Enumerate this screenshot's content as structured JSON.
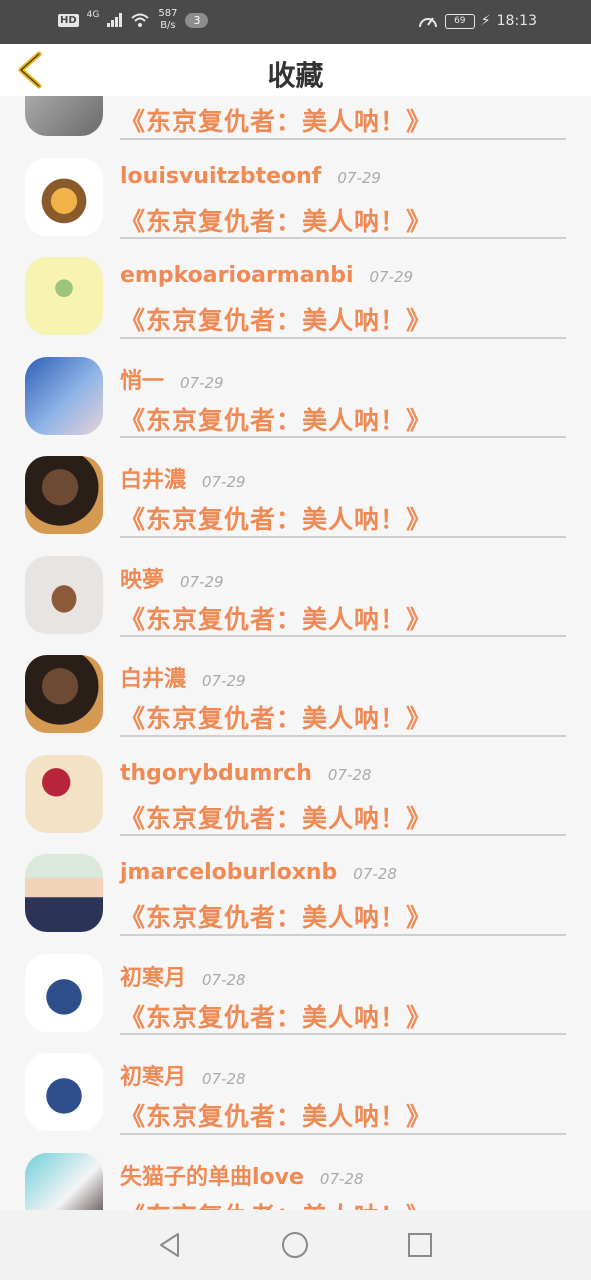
{
  "status_bar": {
    "network_type": "HD",
    "signal": "4G",
    "net_speed_value": "587",
    "net_speed_unit": "B/s",
    "notification_count": "3",
    "battery": "69",
    "time": "18:13"
  },
  "header": {
    "title": "收藏"
  },
  "items": [
    {
      "name": "",
      "date": "",
      "book": "《东京复仇者：美人呐！》"
    },
    {
      "name": "louisvuitzbteonf",
      "date": "07-29",
      "book": "《东京复仇者：美人呐！》"
    },
    {
      "name": "empkoarioarmanbi",
      "date": "07-29",
      "book": "《东京复仇者：美人呐！》"
    },
    {
      "name": "悄一",
      "date": "07-29",
      "book": "《东京复仇者：美人呐！》"
    },
    {
      "name": "白井濃",
      "date": "07-29",
      "book": "《东京复仇者：美人呐！》"
    },
    {
      "name": "映夢",
      "date": "07-29",
      "book": "《东京复仇者：美人呐！》"
    },
    {
      "name": "白井濃",
      "date": "07-29",
      "book": "《东京复仇者：美人呐！》"
    },
    {
      "name": "thgorybdumrch",
      "date": "07-28",
      "book": "《东京复仇者：美人呐！》"
    },
    {
      "name": "jmarceloburloxnb",
      "date": "07-28",
      "book": "《东京复仇者：美人呐！》"
    },
    {
      "name": "初寒月",
      "date": "07-28",
      "book": "《东京复仇者：美人呐！》"
    },
    {
      "name": "初寒月",
      "date": "07-28",
      "book": "《东京复仇者：美人呐！》"
    },
    {
      "name": "失猫子的单曲love",
      "date": "07-28",
      "book": "《东京复仇者：美人呐！》"
    }
  ],
  "colors": {
    "accent": "#ef8a55",
    "status_bar": "#4a4a4a",
    "back_arrow": "#e7b31b"
  }
}
